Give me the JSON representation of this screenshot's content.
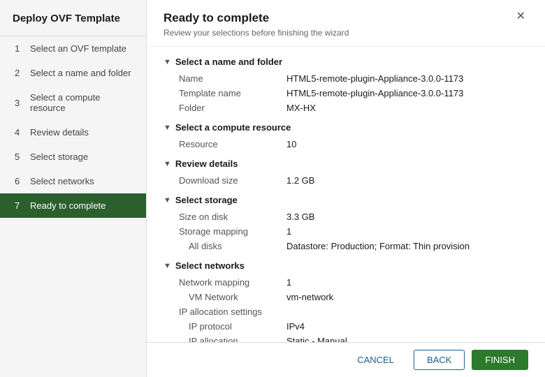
{
  "sidebar": {
    "title": "Deploy OVF Template",
    "items": [
      {
        "id": 1,
        "label": "Select an OVF template",
        "active": false
      },
      {
        "id": 2,
        "label": "Select a name and folder",
        "active": false
      },
      {
        "id": 3,
        "label": "Select a compute resource",
        "active": false
      },
      {
        "id": 4,
        "label": "Review details",
        "active": false
      },
      {
        "id": 5,
        "label": "Select storage",
        "active": false
      },
      {
        "id": 6,
        "label": "Select networks",
        "active": false
      },
      {
        "id": 7,
        "label": "Ready to complete",
        "active": true
      }
    ]
  },
  "header": {
    "title": "Ready to complete",
    "subtitle": "Review your selections before finishing the wizard"
  },
  "sections": {
    "nameAndFolder": {
      "heading": "Select a name and folder",
      "rows": [
        {
          "label": "Name",
          "value": "HTML5-remote-plugin-Appliance-3.0.0-1173"
        },
        {
          "label": "Template name",
          "value": "HTML5-remote-plugin-Appliance-3.0.0-1173"
        },
        {
          "label": "Folder",
          "value": "MX-HX"
        }
      ]
    },
    "computeResource": {
      "heading": "Select a compute resource",
      "rows": [
        {
          "label": "Resource",
          "value": "10"
        }
      ]
    },
    "reviewDetails": {
      "heading": "Review details",
      "rows": [
        {
          "label": "Download size",
          "value": "1.2 GB"
        }
      ]
    },
    "storage": {
      "heading": "Select storage",
      "rows": [
        {
          "label": "Size on disk",
          "value": "3.3 GB"
        },
        {
          "label": "Storage mapping",
          "value": "1"
        },
        {
          "label": "All disks",
          "value": "Datastore: Production; Format: Thin provision"
        }
      ]
    },
    "networks": {
      "heading": "Select networks",
      "rows": [
        {
          "label": "Network mapping",
          "value": "1"
        },
        {
          "label": "VM Network",
          "value": "vm-network"
        },
        {
          "label": "IP allocation settings",
          "value": ""
        },
        {
          "label": "IP protocol",
          "value": "IPv4"
        },
        {
          "label": "IP allocation",
          "value": "Static - Manual"
        }
      ]
    }
  },
  "footer": {
    "cancel_label": "CANCEL",
    "back_label": "BACK",
    "finish_label": "FINISH"
  }
}
